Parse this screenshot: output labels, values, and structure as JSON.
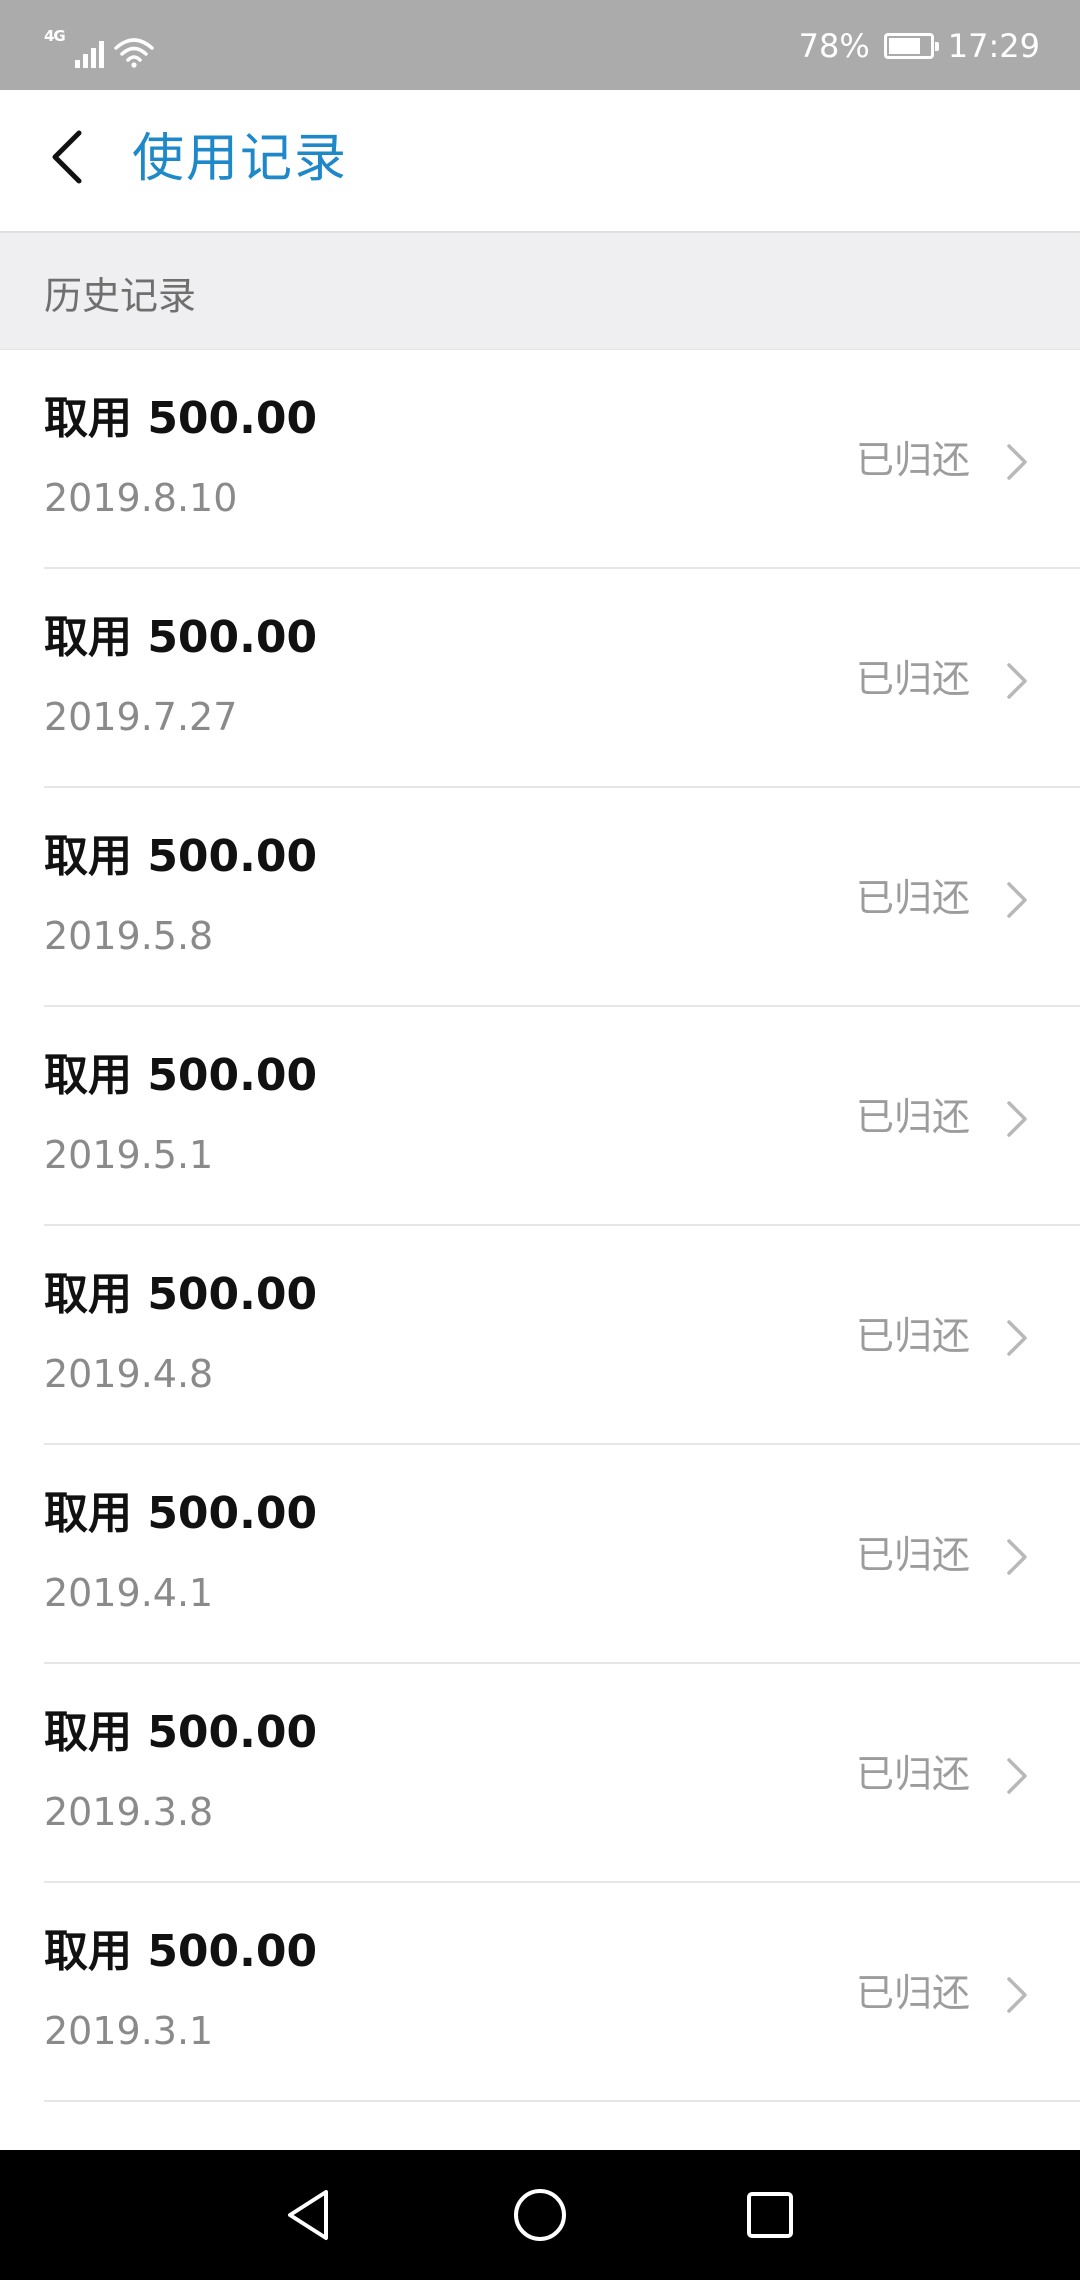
{
  "status_bar": {
    "network": "4G",
    "signal_icon": "signal-icon",
    "wifi_icon": "wifi-icon",
    "battery_text": "78%",
    "battery_level": 0.78,
    "time": "17:29"
  },
  "header": {
    "back_icon": "chevron-left-icon",
    "title": "使用记录",
    "title_color": "#1e88c9"
  },
  "section": {
    "title": "历史记录"
  },
  "records": [
    {
      "amount": "取用 500.00",
      "date": "2019.8.10",
      "status": "已归还"
    },
    {
      "amount": "取用 500.00",
      "date": "2019.7.27",
      "status": "已归还"
    },
    {
      "amount": "取用 500.00",
      "date": "2019.5.8",
      "status": "已归还"
    },
    {
      "amount": "取用 500.00",
      "date": "2019.5.1",
      "status": "已归还"
    },
    {
      "amount": "取用 500.00",
      "date": "2019.4.8",
      "status": "已归还"
    },
    {
      "amount": "取用 500.00",
      "date": "2019.4.1",
      "status": "已归还"
    },
    {
      "amount": "取用 500.00",
      "date": "2019.3.8",
      "status": "已归还"
    },
    {
      "amount": "取用 500.00",
      "date": "2019.3.1",
      "status": "已归还"
    }
  ],
  "nav_bar": {
    "back_icon": "triangle-back-icon",
    "home_icon": "circle-home-icon",
    "recents_icon": "square-recents-icon"
  }
}
